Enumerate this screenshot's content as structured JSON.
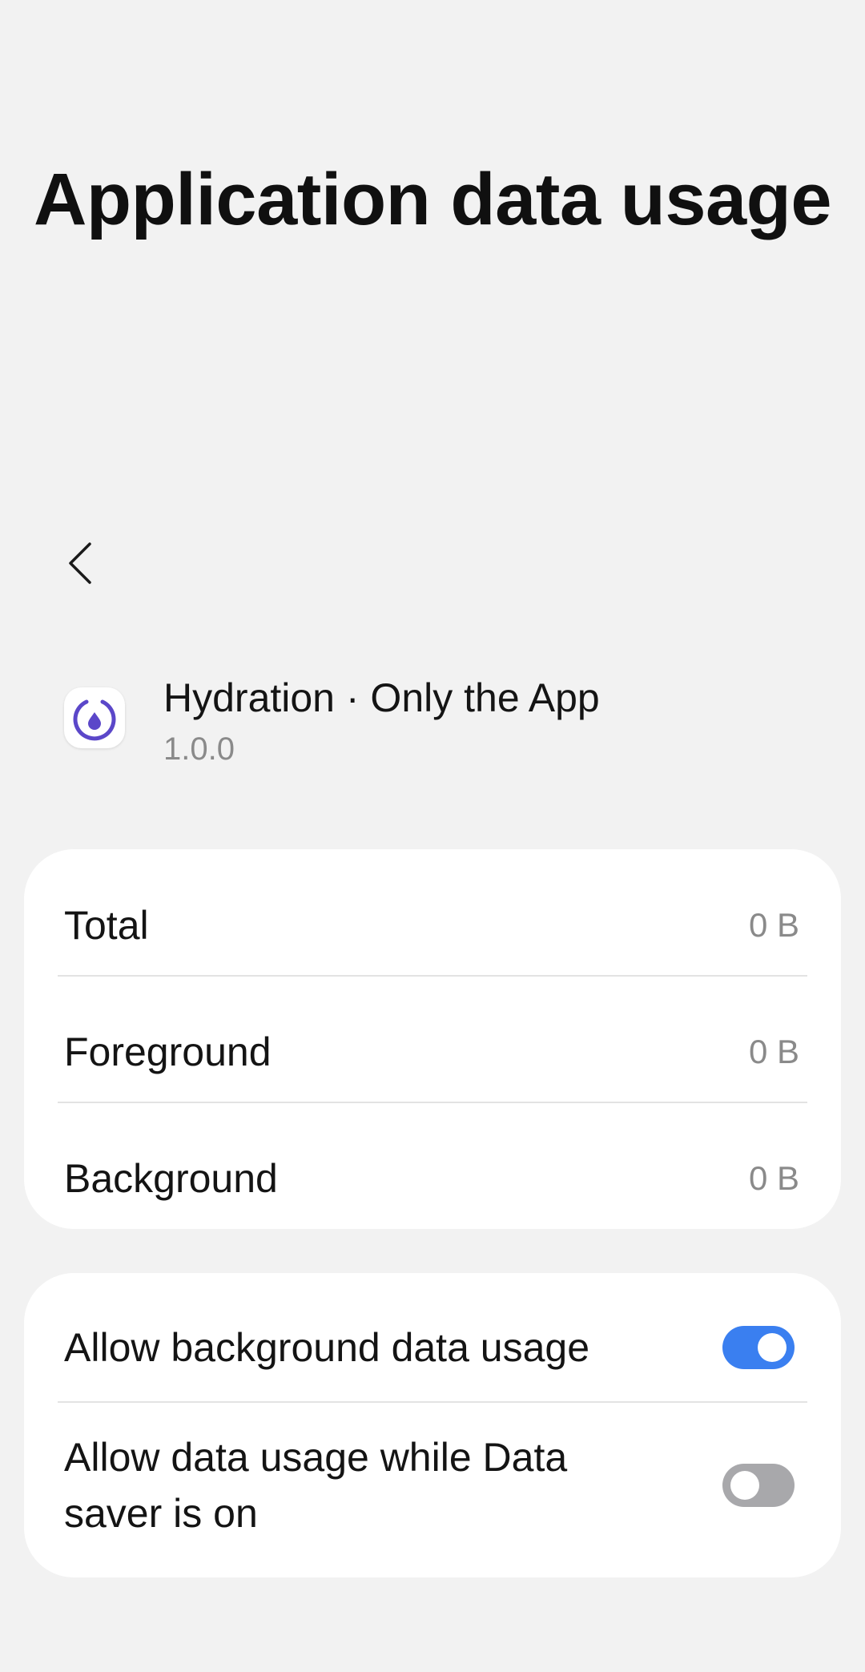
{
  "page": {
    "title": "Application data usage"
  },
  "nav": {
    "back_icon": "chevron-left-icon"
  },
  "app": {
    "name": "Hydration · Only the App",
    "version": "1.0.0",
    "icon": "hydration-ring-icon",
    "icon_color": "#5b47c9"
  },
  "usage": {
    "rows": [
      {
        "label": "Total",
        "value": "0 B"
      },
      {
        "label": "Foreground",
        "value": "0 B"
      },
      {
        "label": "Background",
        "value": "0 B"
      }
    ]
  },
  "toggles": [
    {
      "label": "Allow background data usage",
      "on": true
    },
    {
      "label": "Allow data usage while Data saver is on",
      "on": false
    }
  ],
  "colors": {
    "accent": "#3a7ff0",
    "switch_off": "#a8a8ab",
    "background": "#f2f2f2",
    "secondary_text": "#8a8a8a"
  }
}
